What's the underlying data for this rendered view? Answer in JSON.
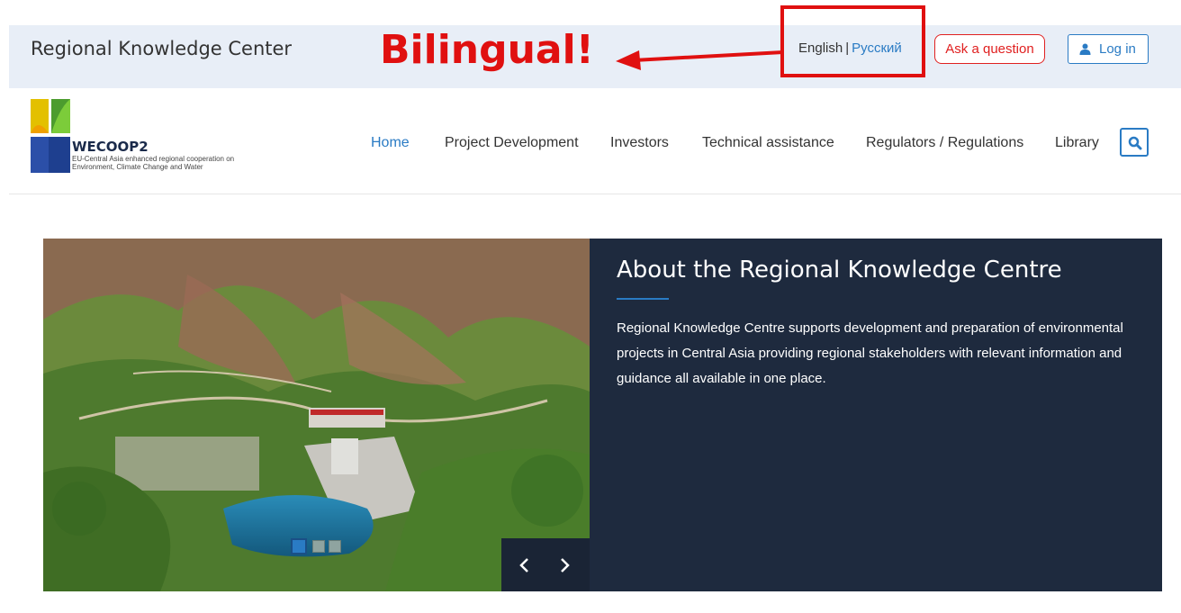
{
  "topbar": {
    "site_title": "Regional Knowledge Center",
    "annotation": "Bilingual!",
    "languages": {
      "current": "English",
      "separator": "|",
      "other": "Русский"
    },
    "ask_label": "Ask a question",
    "login_label": "Log in"
  },
  "logo": {
    "name": "WECOOP2",
    "tagline": "EU-Central Asia enhanced regional cooperation on Environment, Climate Change and Water"
  },
  "nav": {
    "items": [
      {
        "label": "Home",
        "active": true
      },
      {
        "label": "Project Development"
      },
      {
        "label": "Investors"
      },
      {
        "label": "Technical assistance"
      },
      {
        "label": "Regulators / Regulations"
      },
      {
        "label": "Library"
      }
    ]
  },
  "hero": {
    "title": "About the Regional Knowledge Centre",
    "body": "Regional Knowledge Centre supports development and preparation of environmental projects in Central Asia providing regional stakeholders with relevant information and guidance all available in one place.",
    "slides": {
      "count": 3,
      "active": 1
    }
  },
  "colors": {
    "accent": "#2a7bc4",
    "annotation_red": "#e01010",
    "hero_bg": "#1e2a3e",
    "topbar_bg": "#e8eef7"
  },
  "icons": [
    "user-icon",
    "search-icon",
    "chevron-left-icon",
    "chevron-right-icon",
    "arrow-left-icon"
  ]
}
